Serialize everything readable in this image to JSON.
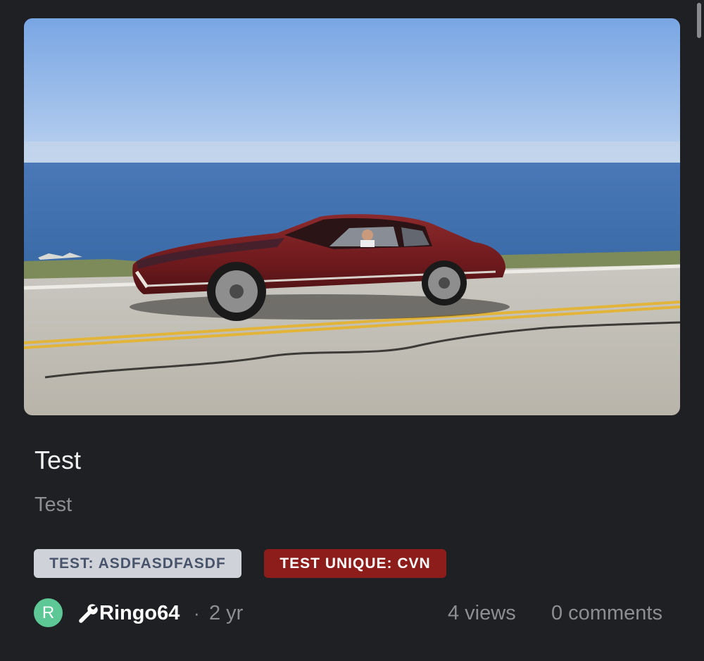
{
  "post": {
    "title": "Test",
    "body": "Test",
    "image": {
      "subject": "red vintage car driving on coastal highway"
    }
  },
  "tags": [
    {
      "label": "TEST: ASDFASDFASDF",
      "color": "#cfd2d8",
      "text_color": "#47546b"
    },
    {
      "label": "TEST UNIQUE: CVN",
      "color": "#8d1d1a",
      "text_color": "#ffffff"
    }
  ],
  "author": {
    "avatar_initial": "R",
    "avatar_color": "#5ec796",
    "icon": "wrench-icon",
    "username": "Ringo64",
    "separator": "·",
    "age": "2 yr"
  },
  "stats": {
    "views": "4 views",
    "comments": "0 comments"
  },
  "colors": {
    "background": "#1f2023",
    "muted_text": "#8d8e92"
  }
}
